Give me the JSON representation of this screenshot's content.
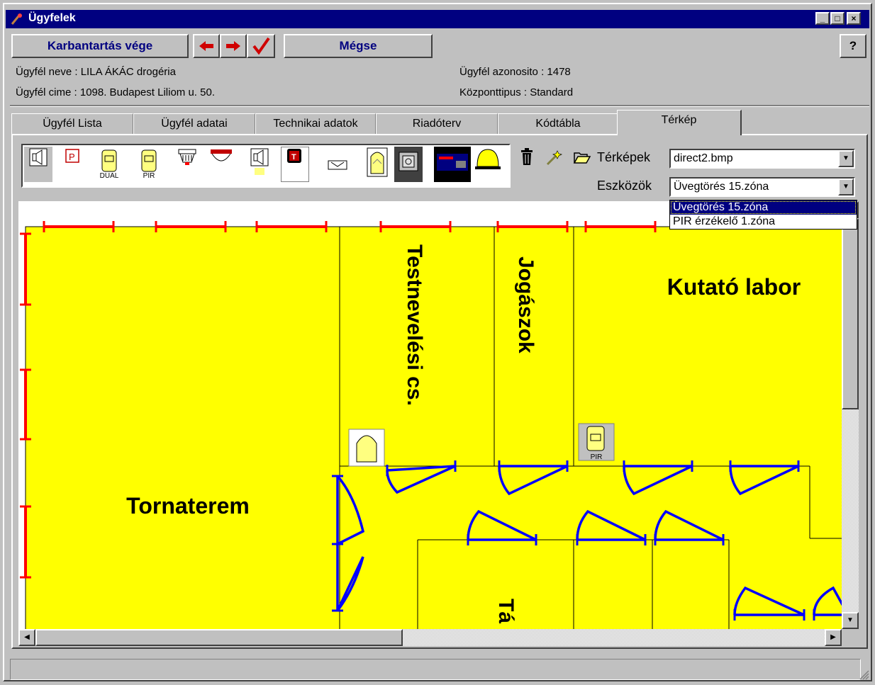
{
  "window": {
    "title": "Ügyfelek",
    "help_icon": "?"
  },
  "toolbar": {
    "finish_label": "Karbantartás vége",
    "cancel_label": "Mégse",
    "prev_icon": "arrow-left-icon",
    "next_icon": "arrow-right-icon",
    "ok_icon": "checkmark-icon"
  },
  "info": {
    "name": "Ügyfél neve : LILA ÁKÁC drogéria",
    "address": "Ügyfél cime : 1098. Budapest Liliom u. 50.",
    "id": "Ügyfél azonosito : 1478",
    "type": "Központtipus : Standard"
  },
  "tabs": [
    {
      "label": "Ügyfél Lista"
    },
    {
      "label": "Ügyfél adatai"
    },
    {
      "label": "Technikai adatok"
    },
    {
      "label": "Riadóterv"
    },
    {
      "label": "Kódtábla"
    },
    {
      "label": "Térkép"
    }
  ],
  "active_tab": "Térkép",
  "map_panel": {
    "maps_label": "Térképek",
    "maps_value": "direct2.bmp",
    "devices_label": "Eszközök",
    "devices_value": "Üvegtörés 15.zóna",
    "device_options": [
      "Üvegtörés 15.zóna",
      "PIR érzékelő 1.zóna"
    ],
    "tool_icon_labels": {
      "dual": "DUAL",
      "pir": "PIR",
      "p": "P",
      "t": "T"
    }
  },
  "map": {
    "rooms": [
      "Tornaterem",
      "Testnevelési cs.",
      "Jogászok",
      "Kutató labor",
      "Tá"
    ],
    "pir_label": "PIR",
    "colors": {
      "floor": "#ffff00",
      "windows": "#ff0000",
      "doors": "#0000ff"
    }
  }
}
